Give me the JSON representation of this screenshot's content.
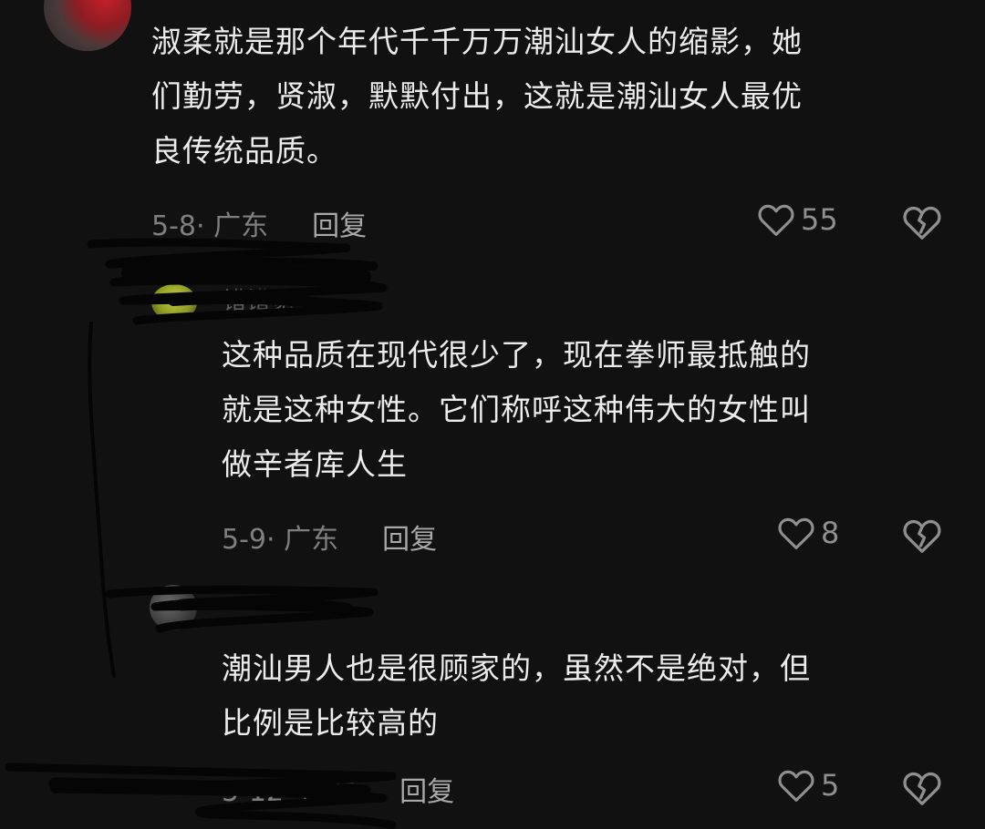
{
  "comments": [
    {
      "username": "",
      "text": "淑柔就是那个年代千千万万潮汕女人的缩影，她们勤劳，贤淑，默默付出，这就是潮汕女人最优良传统品质。",
      "lines": [
        "淑柔就是那个年代千千万万潮汕女人的缩影，她",
        "们勤劳，贤淑，默默付出，这就是潮汕女人最优",
        "良传统品质。"
      ],
      "date_location": "5-8· 广东",
      "reply_label": "回复",
      "likes": "55"
    },
    {
      "username": "错错觉",
      "text": "这种品质在现代很少了，现在拳师最抵触的就是这种女性。它们称呼这种伟大的女性叫做辛者库人生",
      "lines": [
        "这种品质在现代很少了，现在拳师最抵触的",
        "就是这种女性。它们称呼这种伟大的女性叫",
        "做辛者库人生"
      ],
      "date_location": "5-9· 广东",
      "reply_label": "回复",
      "likes": "8"
    },
    {
      "username": "",
      "text": "潮汕男人也是很顾家的，虽然不是绝对，但比例是比较高的",
      "lines": [
        "潮汕男人也是很顾家的，虽然不是绝对，但",
        "比例是比较高的"
      ],
      "date_location": "5-12· 广东",
      "reply_label": "回复",
      "likes": "5"
    }
  ],
  "colors": {
    "background": "#111111",
    "text": "#ececec",
    "meta": "#7f7f7f",
    "icon": "#8f8f8f"
  },
  "icons": {
    "like": "heart-outline-icon",
    "dislike": "broken-heart-icon"
  }
}
